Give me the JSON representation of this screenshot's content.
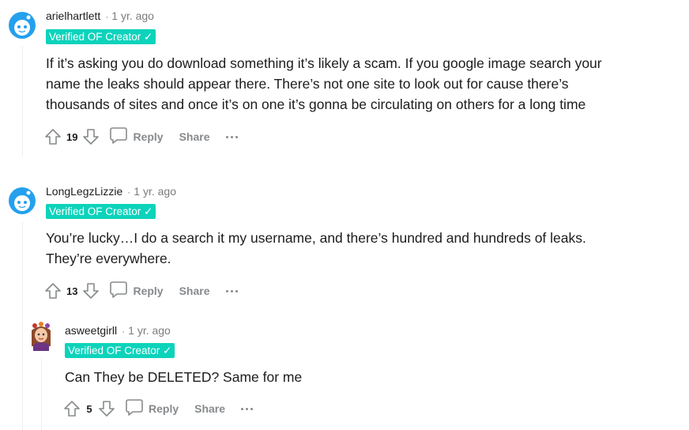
{
  "comments": [
    {
      "author": "arielhartlett",
      "separator": "·",
      "time": "1 yr. ago",
      "flair": "Verified OF Creator ✓",
      "lines": [
        "If it’s asking you do download something it’s likely a scam. If you google image search your",
        "name the leaks should appear there. There’s not one site to look out for cause there’s",
        "thousands of sites and once it’s on one it’s gonna be circulating on others for a long time"
      ],
      "score": "19",
      "reply": "Reply",
      "share": "Share",
      "avatar_icon": "snoo-avatar-icon"
    },
    {
      "author": "LongLegzLizzie",
      "separator": "·",
      "time": "1 yr. ago",
      "flair": "Verified OF Creator ✓",
      "lines": [
        "You’re lucky…I do a search it my username, and there’s hundred and hundreds of leaks.",
        "They’re everywhere."
      ],
      "score": "13",
      "reply": "Reply",
      "share": "Share",
      "avatar_icon": "snoo-avatar-icon"
    },
    {
      "author": "asweetgirll",
      "separator": "·",
      "time": "1 yr. ago",
      "flair": "Verified OF Creator ✓",
      "lines": [
        "Can They be DELETED? Same for me"
      ],
      "score": "5",
      "reply": "Reply",
      "share": "Share",
      "avatar_icon": "custom-avatar-icon"
    }
  ],
  "colors": {
    "flair_bg": "#0dd3bb",
    "meta_gray": "#7c7c7c",
    "action_gray": "#878a8c",
    "thread_line": "#edeff1",
    "avatar_blue": "#24a0ed"
  }
}
